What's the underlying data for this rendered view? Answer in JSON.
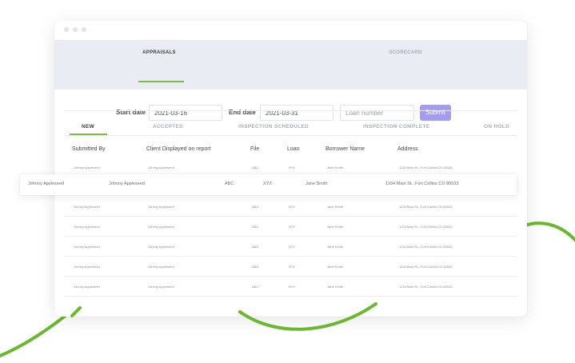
{
  "app": {
    "top_tabs": [
      {
        "label": "APPRAISALS",
        "active": true
      },
      {
        "label": "SCORECARD",
        "active": false
      }
    ],
    "filters": {
      "start_date_label": "Start date",
      "start_date_value": "2021-03-16",
      "end_date_label": "End date",
      "end_date_value": "2021-03-31",
      "loan_number_placeholder": "Loan number",
      "submit_label": "Submit"
    },
    "status_tabs": [
      {
        "label": "NEW",
        "active": true
      },
      {
        "label": "ACCEPTED",
        "active": false
      },
      {
        "label": "INSPECTION SCHEDULED",
        "active": false
      },
      {
        "label": "INSPECTION COMPLETE",
        "active": false
      },
      {
        "label": "ON HOLD",
        "active": false
      }
    ],
    "table": {
      "columns": [
        "Submitted By",
        "Client Displayed on report",
        "File",
        "Loan",
        "Borrower Name",
        "Address"
      ],
      "rows": [
        [
          "Johnny Appleseed",
          "Johnny Appleseed",
          "ABC",
          "XYZ",
          "Jane Smith",
          "1234 Main St., Fort Collins CO 80533"
        ],
        [
          "Johnny Appleseed",
          "Johnny Appleseed",
          "ABC",
          "XYZ",
          "Jane Smith",
          "1234 Main St., Fort Collins CO 80533"
        ],
        [
          "Johnny Appleseed",
          "Johnny Appleseed",
          "ABC",
          "XYZ",
          "Jane Smith",
          "1234 Main St., Fort Collins CO 80533"
        ],
        [
          "Johnny Appleseed",
          "Johnny Appleseed",
          "ABC",
          "XYZ",
          "Jane Smith",
          "1234 Main St., Fort Collins CO 80533"
        ],
        [
          "Johnny Appleseed",
          "Johnny Appleseed",
          "ABC",
          "XYZ",
          "Jane Smith",
          "1234 Main St., Fort Collins CO 80533"
        ],
        [
          "Johnny Appleseed",
          "Johnny Appleseed",
          "ABC",
          "XYZ",
          "Jane Smith",
          "1234 Main St., Fort Collins CO 80533"
        ]
      ],
      "highlighted_row": [
        "Johnny Appleseed",
        "Johnny Appleseed",
        "ABC",
        "XYZ",
        "Jane Smith",
        "1234 Main St., Fort Collins CO 80533"
      ]
    },
    "colors": {
      "accent_green": "#7bbf42",
      "submit_purple": "#a29df3",
      "tab_bar_bg": "#e9ecf2",
      "decor_line_green": "#6ab830"
    }
  }
}
